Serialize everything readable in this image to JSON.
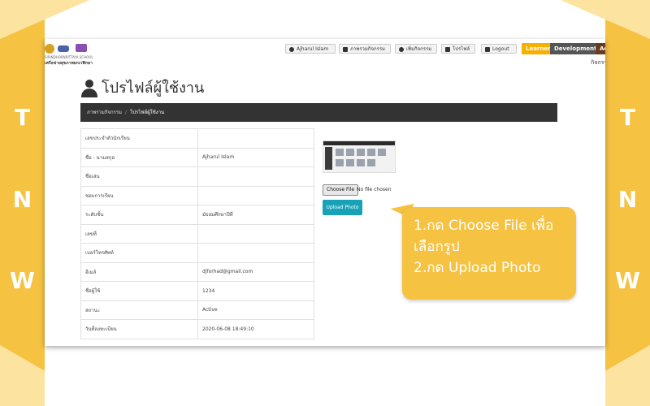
{
  "frame": {
    "letters": [
      "T",
      "N",
      "W"
    ],
    "color": "#f5c242",
    "light_color": "#fce3a0"
  },
  "header": {
    "logo_text_1": "SIRINDHORNRITTAYA SCHOOL",
    "logo_text_2": "เครือข่ายสุขภาพยกเวฟิกษา",
    "nav": [
      {
        "label": "Ajharul Islam",
        "icon": "user-icon"
      },
      {
        "label": "ภาพรวมกิจกรรม",
        "icon": "images-icon"
      },
      {
        "label": "เพิ่มกิจกรรม",
        "icon": "plus-circle-icon"
      },
      {
        "label": "โปรไฟล์",
        "icon": "id-card-icon"
      },
      {
        "label": "Logout",
        "icon": "logout-icon"
      }
    ],
    "tags": {
      "learner": "Learner",
      "development": "Development",
      "ac": "Ac"
    },
    "activity_text": "กิจกรร"
  },
  "page": {
    "title": "โปรไฟล์ผู้ใช้งาน",
    "breadcrumb": {
      "parent": "ภาพรวมกิจกรรม",
      "separator": "/",
      "current": "โปรไฟล์ผู้ใช้งาน"
    }
  },
  "profile_rows": [
    {
      "label": "เลขประจำตัวนักเรียน",
      "value": ""
    },
    {
      "label": "ชื่อ - นามสกุล",
      "value": "Ajharul Islam"
    },
    {
      "label": "ชื่อเล่น",
      "value": ""
    },
    {
      "label": "ชอบการเรียน",
      "value": ""
    },
    {
      "label": "ระดับชั้น",
      "value": "มัธยมศึกษาปีที่"
    },
    {
      "label": "เลขที่",
      "value": ""
    },
    {
      "label": "เบอร์โทรศัพท์",
      "value": ""
    },
    {
      "label": "อีเมล์",
      "value": "djforhad@gmail.com"
    },
    {
      "label": "ชื่อผู้ใช้",
      "value": "1234"
    },
    {
      "label": "สถานะ",
      "value": "Active"
    },
    {
      "label": "วันที่ลงทะเบียน",
      "value": "2020-06-08 18:49:10"
    }
  ],
  "upload": {
    "choose_label": "Choose File",
    "no_file_text": "No file chosen",
    "upload_label": "Upload Photo",
    "accent": "#17a2b8"
  },
  "callout": {
    "text": "1.กด Choose File เพื่อ\nเลือกรูป\n2.กด Upload Photo"
  }
}
